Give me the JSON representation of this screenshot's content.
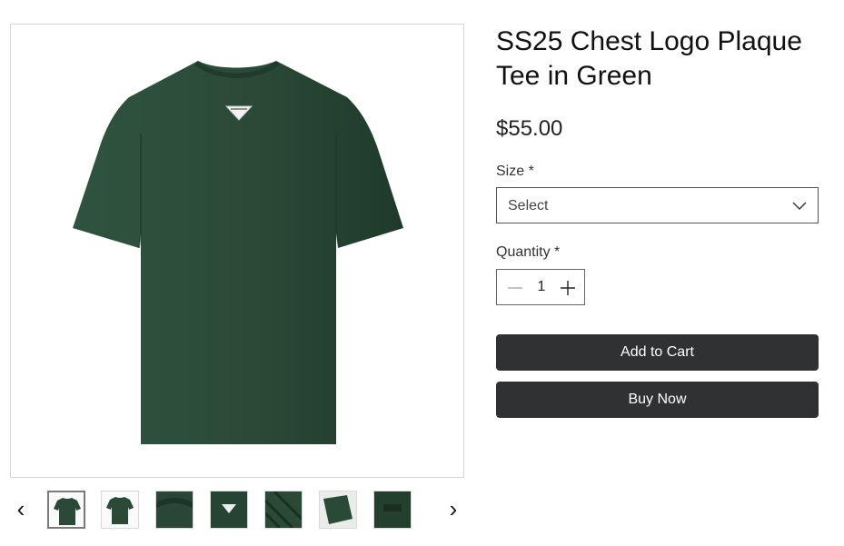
{
  "product": {
    "title": "SS25 Chest Logo Plaque Tee in Green",
    "price": "$55.00",
    "image_alt": "green t-shirt with triangle logo plaque",
    "colors": {
      "shirt": "#2a4a37",
      "shirt_shadow": "#223d2d",
      "button": "#303132"
    }
  },
  "options": {
    "size_label": "Size *",
    "size_value": "Select",
    "quantity_label": "Quantity *",
    "quantity_value": "1"
  },
  "actions": {
    "add_to_cart": "Add to Cart",
    "buy_now": "Buy Now"
  },
  "gallery": {
    "prev_icon": "‹",
    "next_icon": "›",
    "thumbnails": [
      {
        "name": "front view",
        "active": true
      },
      {
        "name": "front view"
      },
      {
        "name": "collar detail"
      },
      {
        "name": "logo plaque closeup"
      },
      {
        "name": "fabric texture"
      },
      {
        "name": "sleeve hem detail"
      },
      {
        "name": "neck label"
      }
    ]
  }
}
